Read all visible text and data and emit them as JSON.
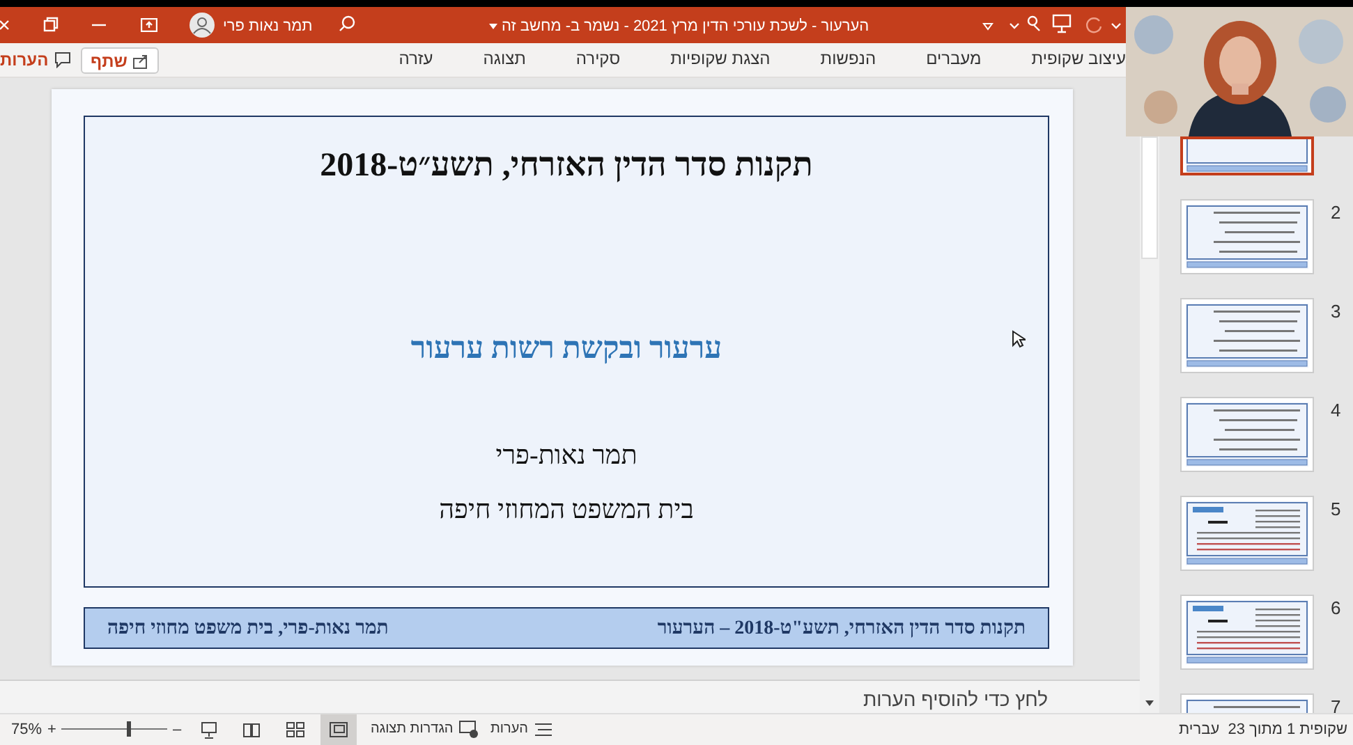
{
  "title_bar": {
    "user_name": "תמר נאות פרי",
    "document_title": "הערעור - לשכת עורכי הדין מרץ 2021 - נשמר ב- מחשב זה"
  },
  "ribbon": {
    "tabs": [
      {
        "label": "עיצוב שקופית",
        "selected": false
      },
      {
        "label": "מעברים",
        "selected": false
      },
      {
        "label": "הנפשות",
        "selected": false
      },
      {
        "label": "הצגת שקופיות",
        "selected": false
      },
      {
        "label": "סקירה",
        "selected": false
      },
      {
        "label": "תצוגה",
        "selected": false
      },
      {
        "label": "עזרה",
        "selected": false
      }
    ],
    "share_button": "שתף",
    "comments_button": "הערות"
  },
  "slide": {
    "title": "תקנות סדר הדין האזרחי, תשע״ט-2018",
    "subtitle": "ערעור ובקשת רשות ערעור",
    "author": "תמר נאות-פרי",
    "court": "בית המשפט המחוזי חיפה",
    "footer_right": "תקנות סדר הדין האזרחי, תשע\"ט-2018 – הערעור",
    "footer_left": "תמר נאות-פרי, בית משפט מחוזי חיפה"
  },
  "notes": {
    "placeholder": "לחץ כדי להוסיף הערות"
  },
  "thumbnails": [
    {
      "kind": "title",
      "selected": true
    },
    {
      "number": "2",
      "kind": "bullets",
      "selected": false
    },
    {
      "number": "3",
      "kind": "bullets",
      "selected": false
    },
    {
      "number": "4",
      "kind": "bullets",
      "selected": false
    },
    {
      "number": "5",
      "kind": "form",
      "selected": false
    },
    {
      "number": "6",
      "kind": "form",
      "selected": false
    },
    {
      "number": "7",
      "kind": "bullets",
      "selected": false
    }
  ],
  "status_bar": {
    "slide_counter": "שקופית 1 מתוך 23",
    "language": "עברית",
    "notes_button": "הערות",
    "display_settings": "הגדרות תצוגה",
    "views": [
      {
        "kind": "presenter",
        "selected": false
      },
      {
        "kind": "reading",
        "selected": false
      },
      {
        "kind": "sorter",
        "selected": false
      },
      {
        "kind": "normal",
        "selected": true
      }
    ],
    "zoom_out": "–",
    "zoom_in": "+",
    "zoom": {
      "level": 0.63,
      "reading": "75%"
    }
  }
}
